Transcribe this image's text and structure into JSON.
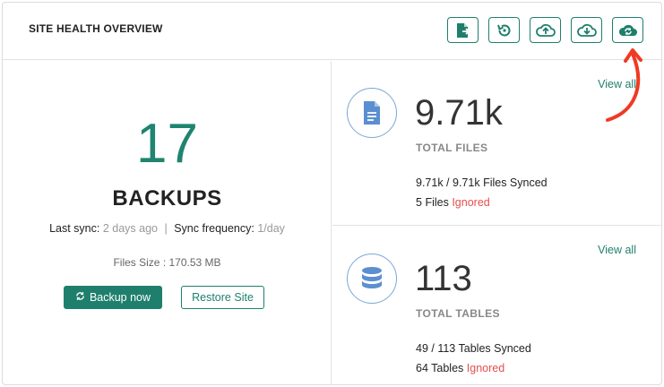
{
  "header": {
    "title": "SITE HEALTH OVERVIEW",
    "toolbar_icons": [
      "file-export-icon",
      "restore-history-icon",
      "cloud-upload-icon",
      "cloud-download-icon",
      "cloud-sync-icon"
    ]
  },
  "backups": {
    "count": "17",
    "label": "BACKUPS",
    "last_sync_label": "Last sync:",
    "last_sync_value": "2 days ago",
    "separator": "|",
    "frequency_label": "Sync frequency:",
    "frequency_value": "1/day",
    "files_size": "Files Size : 170.53 MB",
    "backup_now": "Backup now",
    "restore_site": "Restore Site"
  },
  "files": {
    "view_all": "View all",
    "count": "9.71k",
    "label": "TOTAL FILES",
    "synced_ratio": "9.71k / 9.71k",
    "synced_text": "Files Synced",
    "ignored_count": "5",
    "ignored_noun": "Files",
    "ignored_text": "Ignored"
  },
  "tables": {
    "view_all": "View all",
    "count": "113",
    "label": "TOTAL TABLES",
    "synced_ratio": "49 / 113",
    "synced_text": "Tables Synced",
    "ignored_count": "64",
    "ignored_noun": "Tables",
    "ignored_text": "Ignored"
  },
  "colors": {
    "accent": "#1f7f6d",
    "count_green": "#1f8470",
    "ignored_red": "#e64e4e",
    "icon_blue": "#5b8fd0",
    "annotation_red": "#f03a23"
  }
}
